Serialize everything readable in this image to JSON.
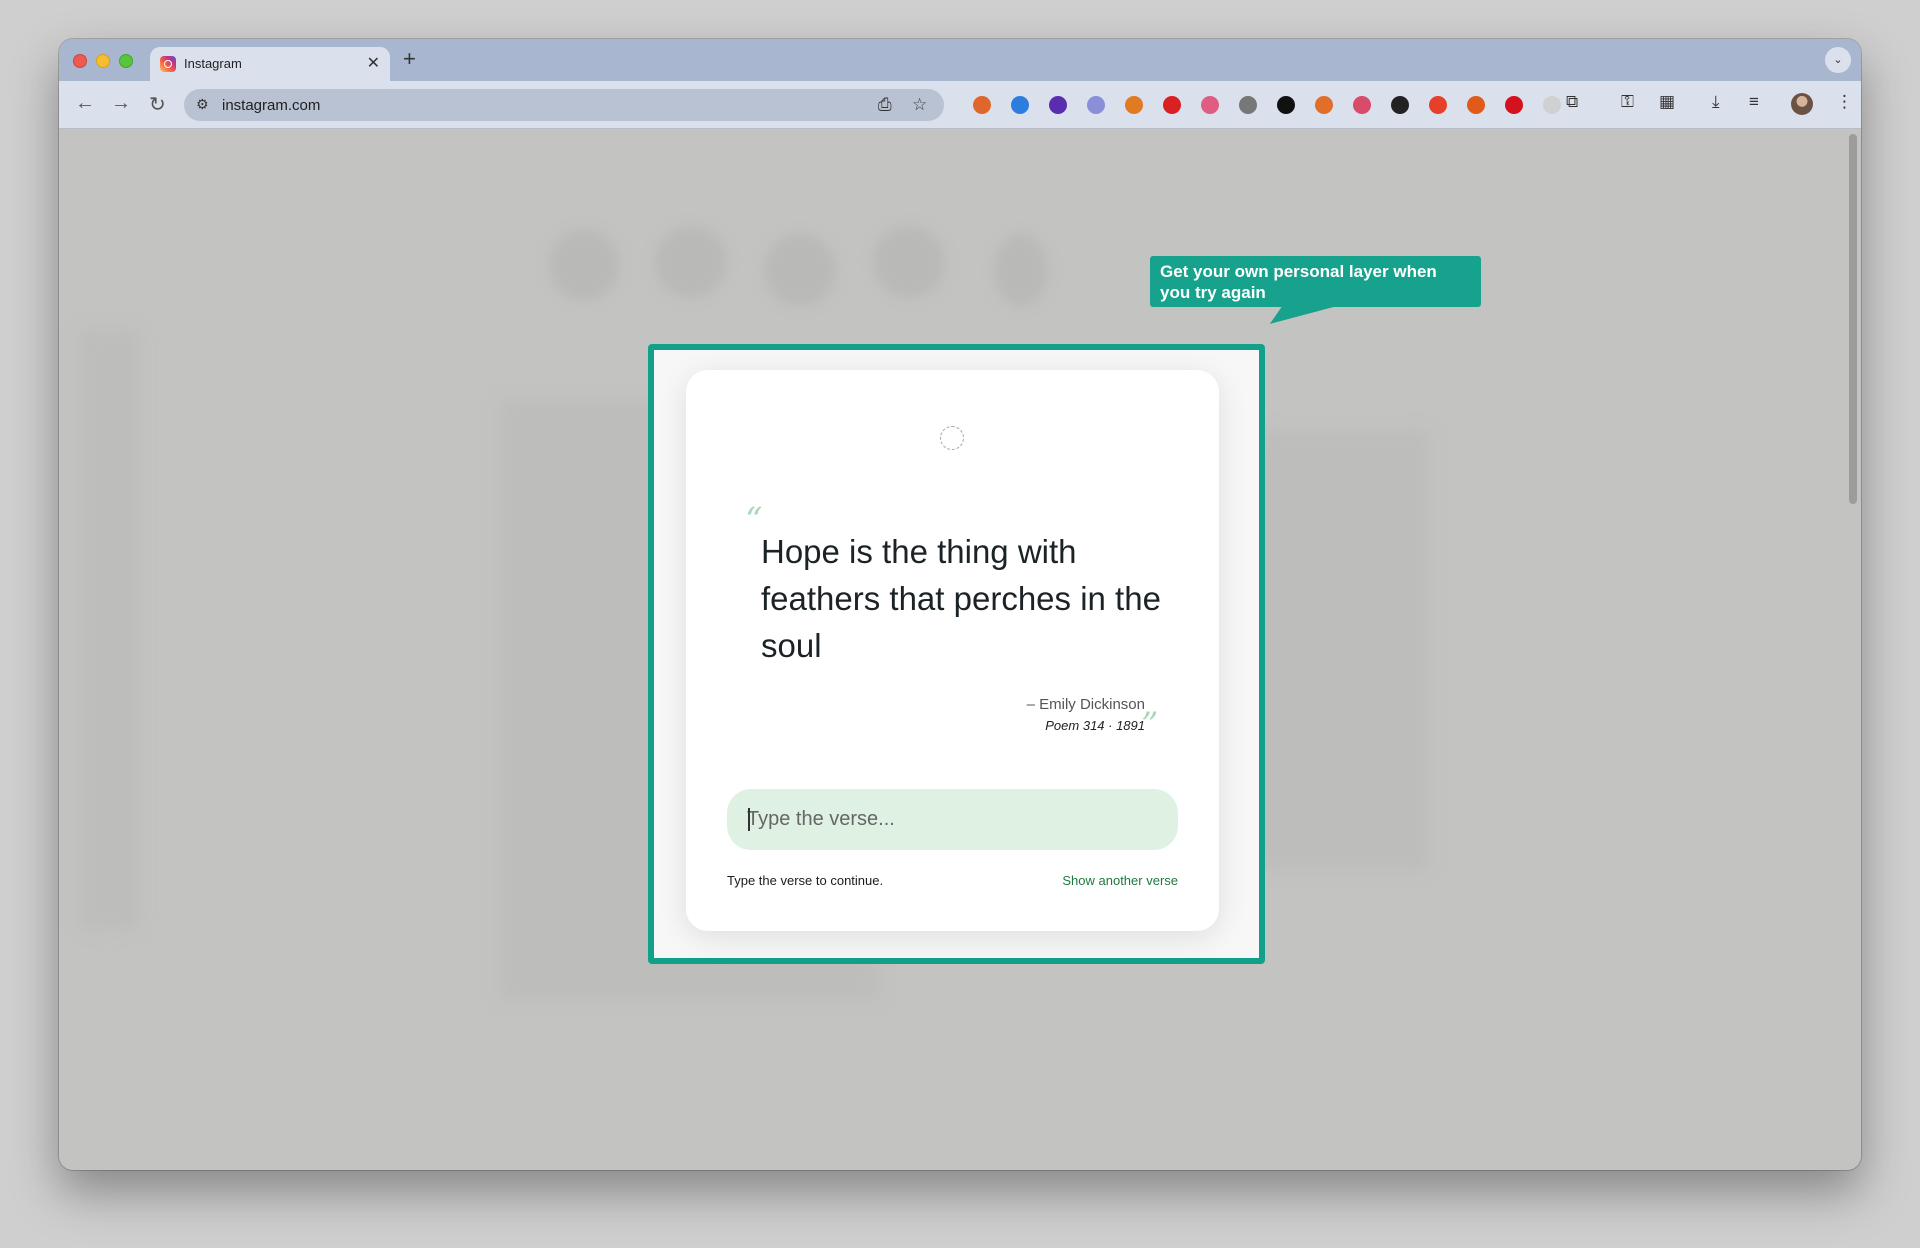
{
  "browser": {
    "tab_title": "Instagram",
    "tab_close": "✕",
    "new_tab": "+",
    "tab_search": "⌄",
    "url": "instagram.com",
    "back": "←",
    "forward": "→",
    "reload": "↻",
    "site_info": "⚙",
    "install": "⎙",
    "bookmark": "☆",
    "menu": "⋮",
    "extensions_icon": "⧉",
    "password_icon": "⚿",
    "qr_icon": "▦",
    "download_icon": "⤓",
    "media_icon": "≡",
    "extension_colors": [
      "#e0672c",
      "#2d7de0",
      "#5a2db0",
      "#8a8fd8",
      "#e07b22",
      "#d92121",
      "#e05d82",
      "#777777",
      "#111111",
      "#e06f2a",
      "#d94b6a",
      "#222222",
      "#e6402a",
      "#e05a1a",
      "#d6111e",
      "#d0d0d0"
    ]
  },
  "tooltip": {
    "text": "Get your own personal layer when you try again"
  },
  "modal": {
    "quote_open": "“",
    "verse": "Hope is the thing with feathers that perches in the soul",
    "author": "– Emily Dickinson",
    "source": "Poem 314 · 1891",
    "quote_close": "”",
    "input_placeholder": "Type the verse...",
    "hint": "Type the verse to continue.",
    "another_link": "Show another verse"
  },
  "colors": {
    "accent": "#13a08a",
    "input_bg": "#dff1e3",
    "link": "#1e7a3c"
  }
}
